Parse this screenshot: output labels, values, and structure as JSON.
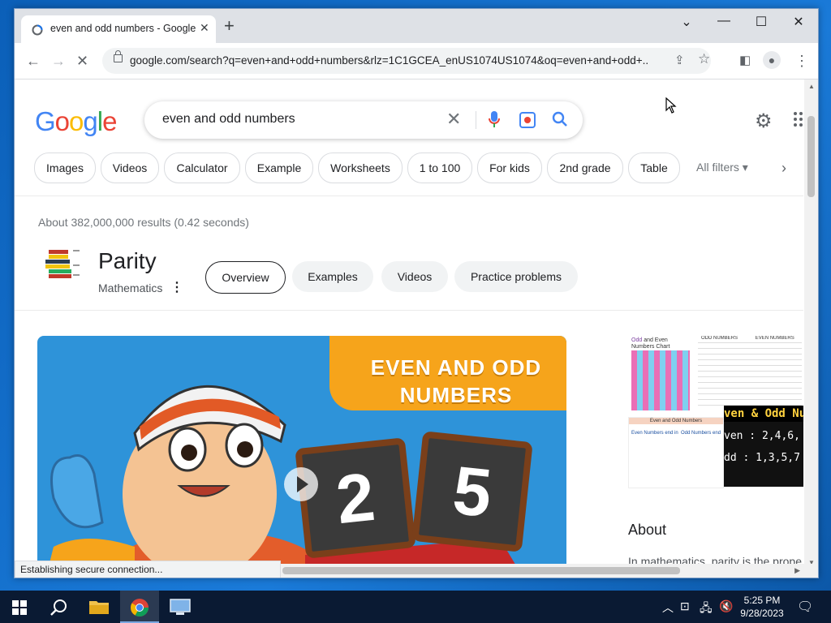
{
  "browser": {
    "tab_title": "even and odd numbers - Google Search",
    "url": "google.com/search?q=even+and+odd+numbers&rlz=1C1GCEA_enUS1074US1074&oq=even+and+odd+...",
    "status_text": "Establishing secure connection..."
  },
  "google": {
    "logo": "Google",
    "query": "even and odd numbers",
    "chips": [
      "Images",
      "Videos",
      "Calculator",
      "Example",
      "Worksheets",
      "1 to 100",
      "For kids",
      "2nd grade",
      "Table"
    ],
    "all_filters": "All filters",
    "result_stats": "About 382,000,000 results (0.42 seconds)",
    "kp_title": "Parity",
    "kp_subtitle": "Mathematics",
    "kp_tabs": [
      "Overview",
      "Examples",
      "Videos",
      "Practice problems"
    ],
    "video_title_line1": "EVEN AND ODD",
    "video_title_line2": "NUMBERS",
    "video_digit_left": "2",
    "video_digit_right": "5",
    "about_heading": "About",
    "about_text": "In mathematics, parity is the prope",
    "image1_title_a": "Odd",
    "image1_title_b": "and Even",
    "image1_title_c": "Numbers Chart",
    "image2_header_a": "ODD NUMBERS",
    "image2_header_b": "EVEN NUMBERS",
    "image3_header": "Even and Odd Numbers",
    "image3_left": "Even Numbers end in",
    "image3_right": "Odd Numbers end",
    "image4_line0": "ven & Odd Nu",
    "image4_line1": "ven : 2,4,6,",
    "image4_line2": "dd : 1,3,5,7"
  },
  "taskbar": {
    "time": "5:25 PM",
    "date": "9/28/2023"
  },
  "colors": {
    "google_blue": "#4285f4",
    "google_red": "#ea4335",
    "google_yellow": "#fbbc05",
    "google_green": "#34a853",
    "taskbar": "#0a1a33"
  }
}
